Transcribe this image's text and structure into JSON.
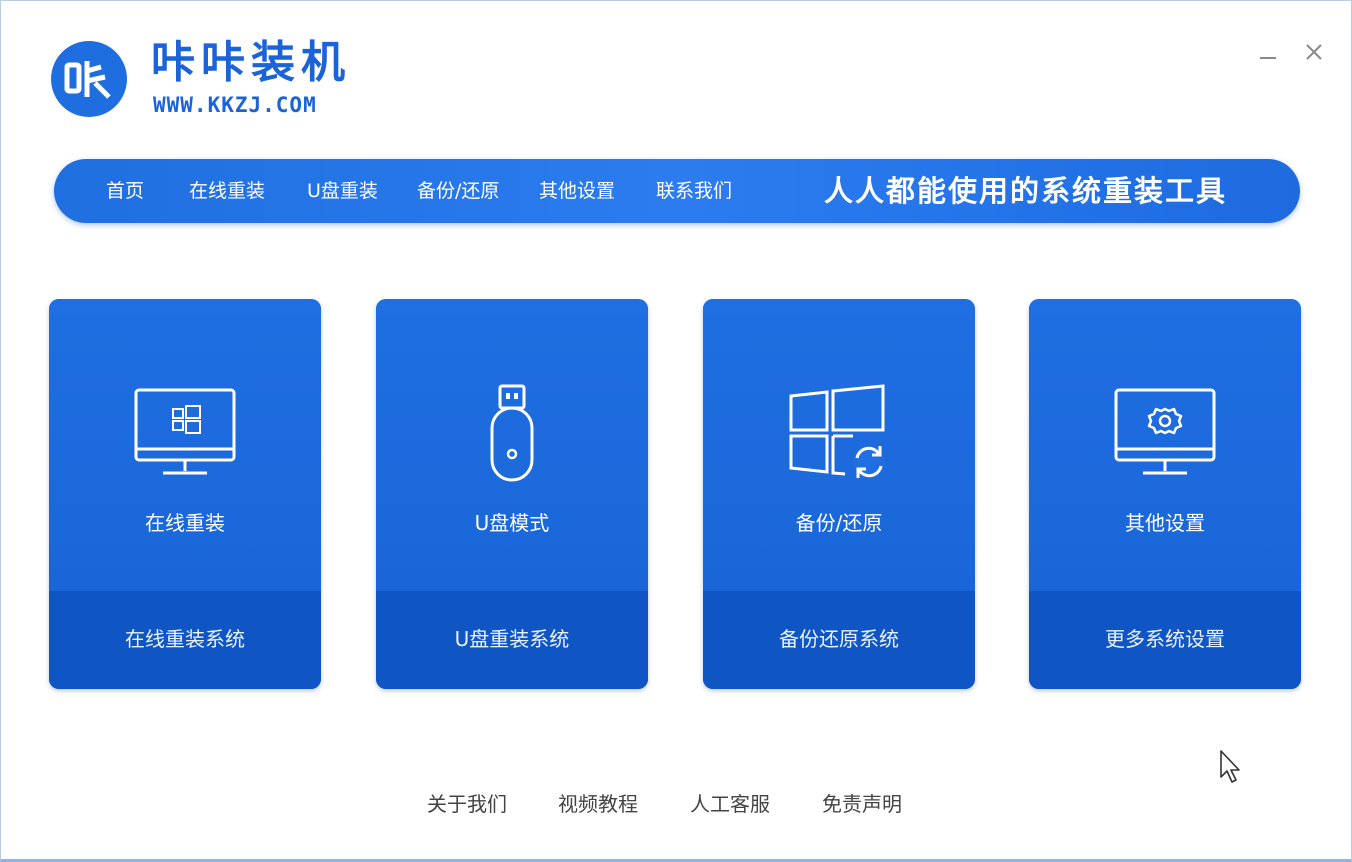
{
  "header": {
    "logo_glyph": "咔",
    "app_title": "咔咔装机",
    "url": "WWW.KKZJ.COM",
    "window_controls": {
      "minimize": "–",
      "close": "✕"
    }
  },
  "nav": {
    "items": [
      {
        "label": "首页"
      },
      {
        "label": "在线重装"
      },
      {
        "label": "U盘重装"
      },
      {
        "label": "备份/还原"
      },
      {
        "label": "其他设置"
      },
      {
        "label": "联系我们"
      }
    ],
    "slogan": "人人都能使用的系统重装工具"
  },
  "cards": [
    {
      "icon": "monitor-windows-icon",
      "label": "在线重装",
      "action": "在线重装系统"
    },
    {
      "icon": "usb-drive-icon",
      "label": "U盘模式",
      "action": "U盘重装系统"
    },
    {
      "icon": "windows-restore-icon",
      "label": "备份/还原",
      "action": "备份还原系统"
    },
    {
      "icon": "monitor-gear-icon",
      "label": "其他设置",
      "action": "更多系统设置"
    }
  ],
  "footer": {
    "links": [
      {
        "label": "关于我们"
      },
      {
        "label": "视频教程"
      },
      {
        "label": "人工客服"
      },
      {
        "label": "免责声明"
      }
    ]
  },
  "colors": {
    "brand": "#1a63d8",
    "card": "#1f6fe2",
    "card_bottom": "#0f56c4"
  }
}
